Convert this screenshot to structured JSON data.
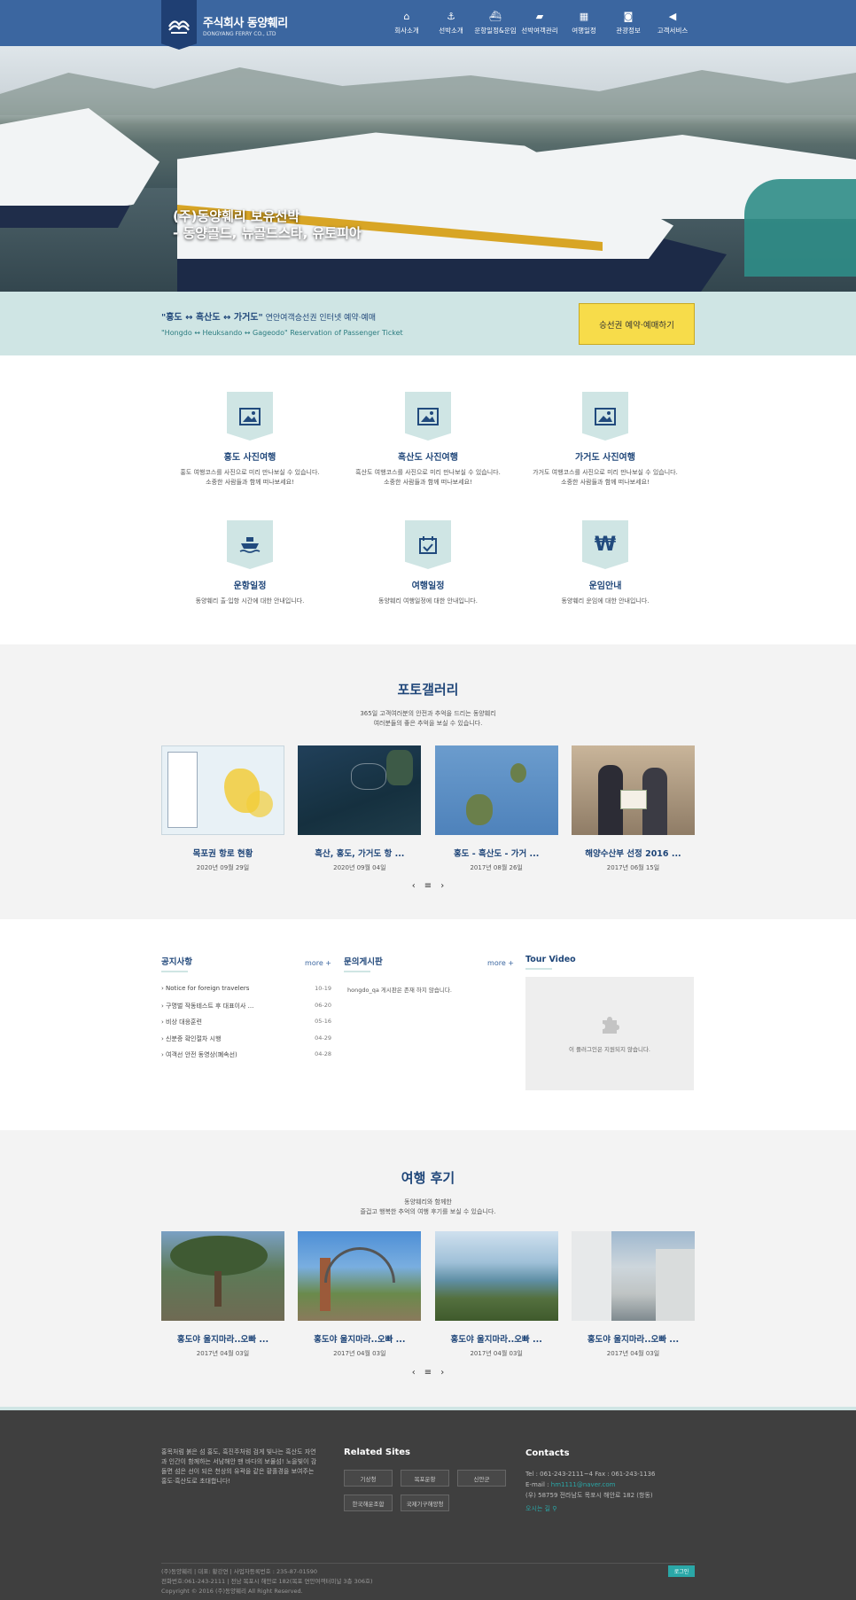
{
  "header": {
    "logo_title": "주식회사 동양훼리",
    "logo_sub": "DONGYANG FERRY CO., LTD",
    "nav": [
      {
        "label": "회사소개",
        "icon": "home-icon",
        "glyph": "⌂"
      },
      {
        "label": "선박소개",
        "icon": "anchor-icon",
        "glyph": "⚓"
      },
      {
        "label": "운항일정&운임",
        "icon": "ship-icon",
        "glyph": "⛴"
      },
      {
        "label": "선박여객관리",
        "icon": "folder-icon",
        "glyph": "▰"
      },
      {
        "label": "여행일정",
        "icon": "calendar-icon",
        "glyph": "▦"
      },
      {
        "label": "관광정보",
        "icon": "camera-icon",
        "glyph": "◙"
      },
      {
        "label": "고객서비스",
        "icon": "megaphone-icon",
        "glyph": "◀"
      }
    ]
  },
  "hero": {
    "caption_line1": "(주)동양훼리 보유선박",
    "caption_line2": "- 동양골드, 뉴골드스타, 유토피아"
  },
  "reservation": {
    "title_quoted": "\"홍도 ↔ 흑산도 ↔ 가거도\"",
    "title_rest": " 연안여객승선권 인터넷 예약·예매",
    "subtitle": "\"Hongdo ↔ Heuksando ↔ Gageodo\" Reservation of Passenger Ticket",
    "button": "승선권 예약·예매하기"
  },
  "features": [
    {
      "title": "홍도 사진여행",
      "desc1": "홍도 여행코스를 사진으로 미리 만나보실 수 있습니다.",
      "desc2": "소중한 사람들과 함께 떠나보세요!",
      "icon": "image-icon",
      "glyph": "🖼"
    },
    {
      "title": "흑산도 사진여행",
      "desc1": "흑산도 여행코스를 사진으로 미리 만나보실 수 있습니다.",
      "desc2": "소중한 사람들과 함께 떠나보세요!",
      "icon": "image-icon",
      "glyph": "🖼"
    },
    {
      "title": "가거도 사진여행",
      "desc1": "가거도 여행코스를 사진으로 미리 만나보실 수 있습니다.",
      "desc2": "소중한 사람들과 함께 떠나보세요!",
      "icon": "image-icon",
      "glyph": "🖼"
    },
    {
      "title": "운항일정",
      "desc1": "동양훼리 출·입항 시간에 대한 안내입니다.",
      "desc2": "",
      "icon": "ship-icon",
      "glyph": "⛴"
    },
    {
      "title": "여행일정",
      "desc1": "동양훼리 여행일정에 대한 안내입니다.",
      "desc2": "",
      "icon": "calendar-check-icon",
      "glyph": "☑"
    },
    {
      "title": "운임안내",
      "desc1": "동양훼리 운임에 대한 안내입니다.",
      "desc2": "",
      "icon": "won-icon",
      "glyph": "₩"
    }
  ],
  "gallery": {
    "title": "포토갤러리",
    "sub1": "365일 고객여러분의 안전과 추억을 드리는 동양훼리",
    "sub2": "여러분들의 좋은 추억을 보실 수 있습니다.",
    "items": [
      {
        "title": "목포권 항로 현황",
        "date": "2020년 09월 29일"
      },
      {
        "title": "흑산, 홍도, 가거도 항 ...",
        "date": "2020년 09월 04일"
      },
      {
        "title": "홍도 - 흑산도 - 가거 ...",
        "date": "2017년 08월 26일"
      },
      {
        "title": "해양수산부 선정 2016 ...",
        "date": "2017년 06월 15일"
      }
    ]
  },
  "pager": {
    "prev": "‹",
    "list": "≡",
    "next": "›"
  },
  "notice": {
    "title": "공지사항",
    "more": "more +",
    "items": [
      {
        "text": "Notice for foreign travelers",
        "date": "10-19"
      },
      {
        "text": "구명벌 작동테스트 후 대표이사 ...",
        "date": "06-20"
      },
      {
        "text": "비상 대응훈련",
        "date": "05-16"
      },
      {
        "text": "신분증 확인절차 시행",
        "date": "04-29"
      },
      {
        "text": "여객선 안전 동영상(폐속선)",
        "date": "04-28"
      }
    ]
  },
  "qna": {
    "title": "문의게시판",
    "more": "more +",
    "empty": "hongdo_qa 게시판은 존재 하지 않습니다."
  },
  "video": {
    "title": "Tour Video",
    "message": "이 플러그인은 지원되지 않습니다."
  },
  "reviews": {
    "title": "여행 후기",
    "sub1": "동양훼리와 함께한",
    "sub2": "즐겁고 행복한 추억의 여행 후기를 보실 수 있습니다.",
    "items": [
      {
        "title": "홍도야 울지마라..오빠 ...",
        "date": "2017년 04월 03일"
      },
      {
        "title": "홍도야 울지마라..오빠 ...",
        "date": "2017년 04월 03일"
      },
      {
        "title": "홍도야 울지마라..오빠 ...",
        "date": "2017년 04월 03일"
      },
      {
        "title": "홍도야 울지마라..오빠 ...",
        "date": "2017년 04월 03일"
      }
    ]
  },
  "footer": {
    "about": "홍목처럼 붉은 섬 홍도, 흑진주처럼 검게 빛나는 흑산도 자연과 인간이 함께하는 서남해안 맨 바다의 보물섬! 노을빛이 감돌면 섬은 선이 되은 천상의 유곽을 같은 황홀경을 보여주는 홍도·흑산도로 초대합니다!",
    "related_title": "Related Sites",
    "sites": [
      "기상청",
      "목포운항",
      "신안군",
      "한국해운조합",
      "국제기구해양청"
    ],
    "contact_title": "Contacts",
    "tel": "Tel : 061-243-2111~4     Fax : 061-243-1136",
    "email_label": "E-mail : ",
    "email": "hm1111@naver.com",
    "address": "(우) 58759 전라남도 목포시 해안로 182 (항동)",
    "map_link": "오시는 길",
    "bottom1": "(주)동양훼리  |  대표: 황강연  |  사업자등록번호 : 235-87-01590",
    "bottom2": "전화번호:061-243-2111  |  전남 목포시 해안로 182(목포 연안여객터미널 3층 306호)",
    "bottom3": "Copyright © 2016 (주)동양훼리 All Right Reserved.",
    "login": "로그인"
  },
  "colors": {
    "header_bg": "#3b66a0",
    "accent_mint": "#cfe5e4",
    "accent_yellow": "#f7dc4a",
    "title_navy": "#1f4679",
    "footer_bg": "#3f3f3f"
  }
}
